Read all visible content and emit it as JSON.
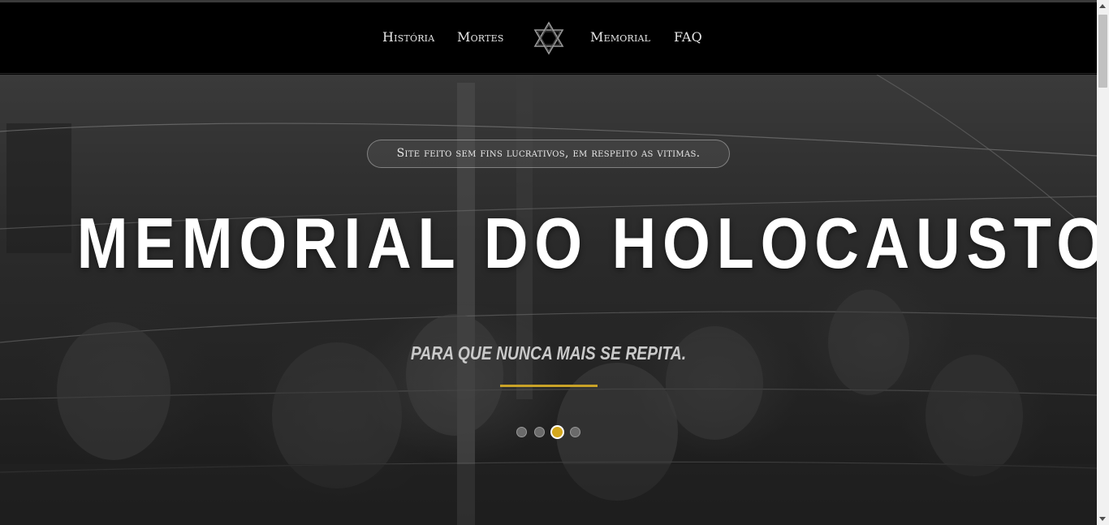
{
  "nav": {
    "items": [
      {
        "label": "História"
      },
      {
        "label": "Mortes"
      },
      {
        "label": "Memorial"
      },
      {
        "label": "FAQ"
      }
    ],
    "logo_icon": "star-of-david-icon"
  },
  "hero": {
    "badge": "Site feito sem fins lucrativos, em respeito as vitimas.",
    "title": "MEMORIAL DO HOLOCAUSTO",
    "tagline": "PARA QUE NUNCA MAIS SE REPITA.",
    "carousel": {
      "slide_count": 4,
      "active_index": 2
    }
  },
  "colors": {
    "accent": "#d4a71d",
    "nav_bg": "#000000",
    "text": "#ffffff"
  }
}
